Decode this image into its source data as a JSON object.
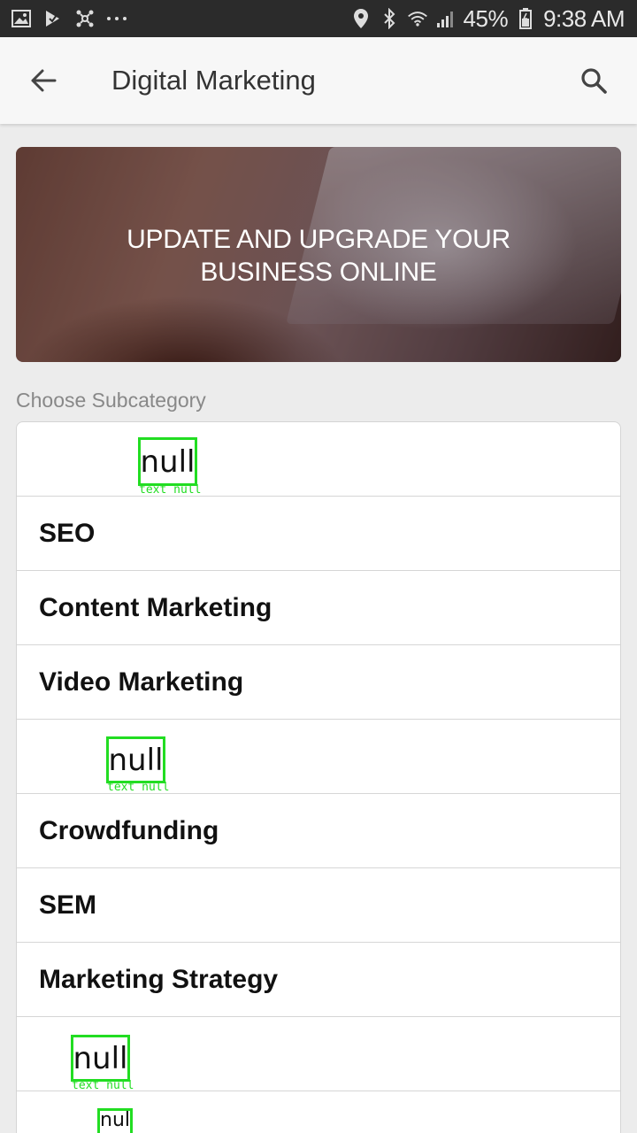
{
  "status_bar": {
    "battery": "45%",
    "time": "9:38 AM",
    "left_icons": [
      "gallery-icon",
      "check-flag-icon",
      "network-icon",
      "more-dots-icon"
    ],
    "right_icons": [
      "location-icon",
      "bluetooth-icon",
      "wifi-icon",
      "signal-icon",
      "battery-icon"
    ]
  },
  "app_bar": {
    "title": "Digital Marketing"
  },
  "banner": {
    "text": "UPDATE AND UPGRADE YOUR\nBUSINESS ONLINE"
  },
  "section": {
    "label": "Choose Subcategory"
  },
  "list": {
    "items": [
      {
        "label": "",
        "overlay": "null",
        "overlay_caption": "text null"
      },
      {
        "label": "SEO"
      },
      {
        "label": "Content Marketing"
      },
      {
        "label": "Video Marketing"
      },
      {
        "label": "",
        "overlay": "null",
        "overlay_caption": "text null"
      },
      {
        "label": "Crowdfunding"
      },
      {
        "label": "SEM"
      },
      {
        "label": "Marketing Strategy"
      },
      {
        "label": "",
        "overlay": "null",
        "overlay_caption": "text null"
      },
      {
        "label": "",
        "overlay": "nul"
      }
    ]
  },
  "colors": {
    "status_bar_bg": "#2b2b2b",
    "app_bar_bg": "#f7f7f7",
    "page_bg": "#ececec",
    "overlay_box": "#22dd22"
  }
}
